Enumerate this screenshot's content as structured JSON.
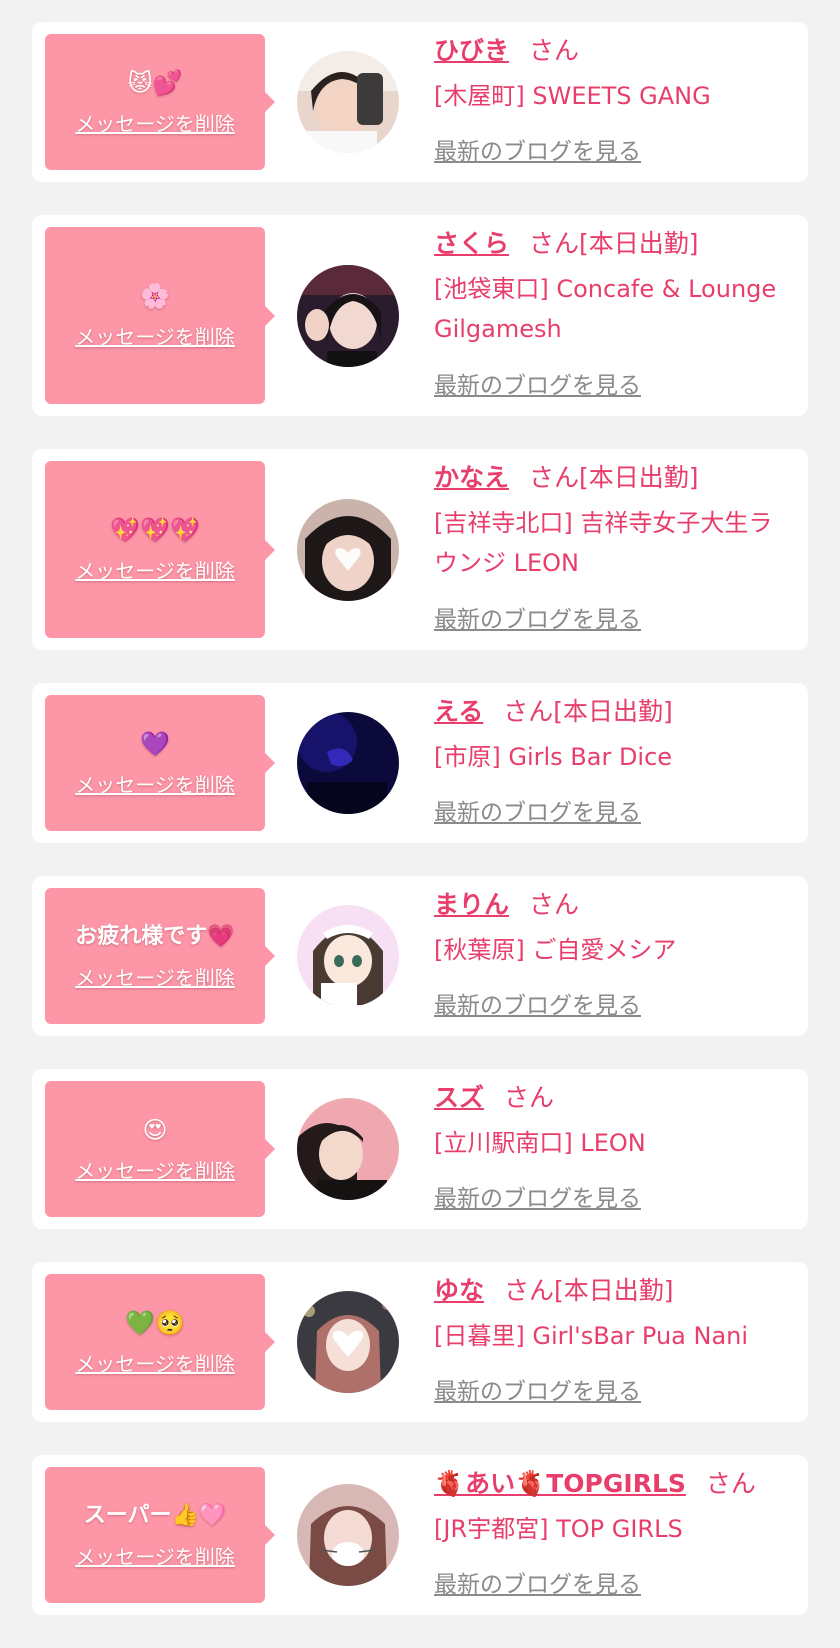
{
  "delete_label": "メッセージを削除",
  "blog_label": "最新のブログを見る",
  "san_suffix": "さん",
  "accent_color": "#e83e6c",
  "message_box_color": "#fd96a6",
  "cards": [
    {
      "message": "😾💕",
      "name": "ひびき",
      "status": "",
      "shop": "[木屋町] SWEETS GANG"
    },
    {
      "message": "🌸",
      "name": "さくら",
      "status": "[本日出勤]",
      "shop": "[池袋東口] Concafe & Lounge Gilgamesh"
    },
    {
      "message": "💖💖💖",
      "name": "かなえ",
      "status": "[本日出勤]",
      "shop": "[吉祥寺北口] 吉祥寺女子大生ラウンジ LEON"
    },
    {
      "message": "💜",
      "name": "える",
      "status": "[本日出勤]",
      "shop": "[市原] Girls Bar Dice"
    },
    {
      "message": "お疲れ様です💗",
      "name": "まりん",
      "status": "",
      "shop": "[秋葉原] ご自愛メシア"
    },
    {
      "message": "😍",
      "name": "スズ",
      "status": "",
      "shop": "[立川駅南口] LEON"
    },
    {
      "message": "💚🥺",
      "name": "ゆな",
      "status": "[本日出勤]",
      "shop": "[日暮里] Girl'sBar Pua Nani"
    },
    {
      "message": "スーパー👍🩷",
      "name": "🫀あい🫀TOPGIRLS",
      "status": "",
      "shop": "[JR宇都宮] TOP GIRLS"
    }
  ]
}
